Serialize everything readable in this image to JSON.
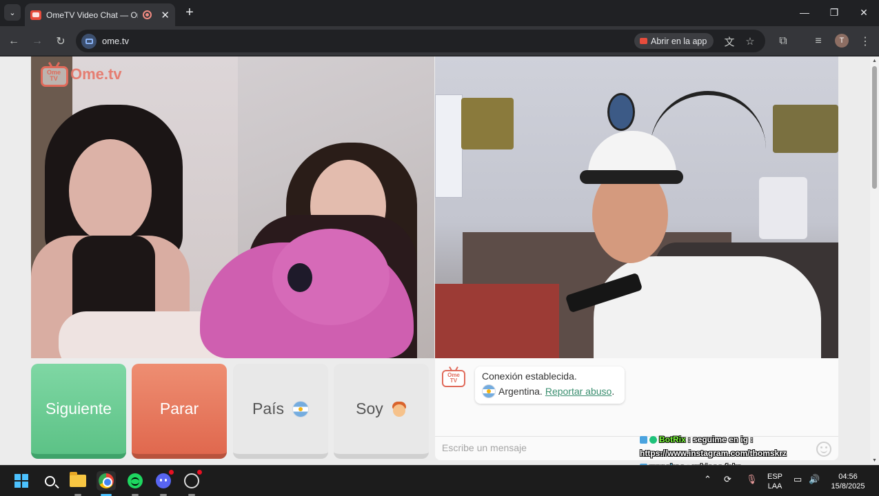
{
  "browser": {
    "tab_title": "OmeTV Video Chat — Omegle alternative",
    "url": "ome.tv",
    "open_in_app": "Abrir en la app",
    "profile_initial": "T",
    "new_tab_symbol": "+",
    "close_tab_symbol": "✕",
    "icons": [
      "tab-list-icon",
      "recording-icon",
      "back-icon",
      "forward-icon",
      "reload-icon",
      "translate-icon",
      "bookmark-star-icon",
      "extensions-icon",
      "media-icon",
      "menu-icon"
    ]
  },
  "window_controls": {
    "minimize": "—",
    "maximize": "❐",
    "close": "✕"
  },
  "site": {
    "logo_text": "Ome.tv",
    "logo_tv_text": "Ome TV",
    "buttons": {
      "next": "Siguiente",
      "stop": "Parar",
      "country": "País",
      "gender": "Soy"
    },
    "chat": {
      "status_message": "Conexión establecida.",
      "country_name": "Argentina.",
      "report_link": "Reportar abuso",
      "report_suffix": ".",
      "input_placeholder": "Escribe un mensaje"
    }
  },
  "stream_overlay": {
    "messages": [
      {
        "user": "BotRix",
        "text": ": seguime en ig :"
      },
      {
        "user": "",
        "text": "https://www.instagram.com/thomskrz"
      },
      {
        "user": "wanakoo",
        "text": ": rubiooo feka"
      }
    ]
  },
  "taskbar": {
    "apps": [
      "start",
      "search",
      "file-explorer",
      "chrome",
      "spotify",
      "discord",
      "obs"
    ],
    "language": "ESP",
    "layout": "LAA",
    "time": "04:56",
    "date": "15/8/2025"
  },
  "colors": {
    "next_button": "#5cc286",
    "stop_button": "#e0684e",
    "brand": "#e06a5a",
    "link": "#3b8f70"
  }
}
